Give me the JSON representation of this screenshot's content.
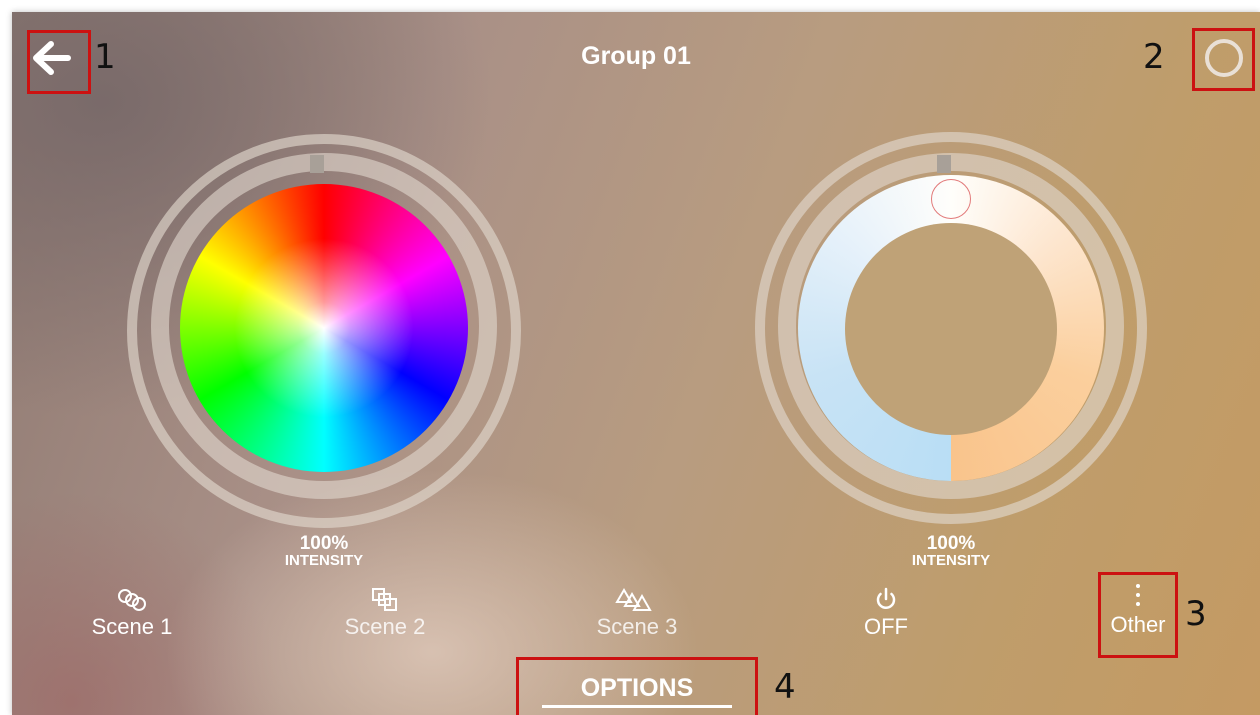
{
  "header": {
    "title": "Group 01",
    "back_icon": "arrow-left-icon",
    "settings_icon": "circle-ring-icon"
  },
  "annotations": {
    "back": "1",
    "settings": "2",
    "other": "3",
    "options": "4",
    "marker_color": "#cc1111"
  },
  "color_panel": {
    "intensity_value": "100%",
    "intensity_label": "INTENSITY"
  },
  "white_panel": {
    "intensity_value": "100%",
    "intensity_label": "INTENSITY"
  },
  "bottom_bar": {
    "items": [
      {
        "label": "Scene 1",
        "icon": "three-circles-icon"
      },
      {
        "label": "Scene 2",
        "icon": "overlapping-squares-icon"
      },
      {
        "label": "Scene 3",
        "icon": "triangles-icon"
      },
      {
        "label": "OFF",
        "icon": "power-icon"
      },
      {
        "label": "Other",
        "icon": "vertical-dots-icon"
      }
    ],
    "options_label": "OPTIONS"
  }
}
